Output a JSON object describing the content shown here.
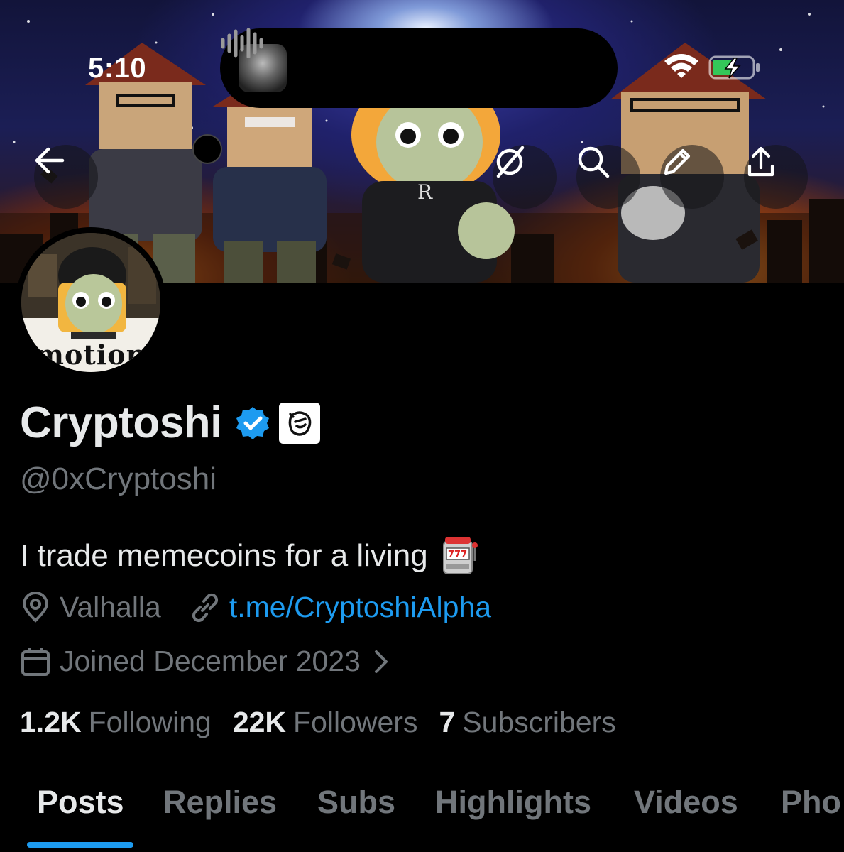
{
  "status_bar": {
    "time": "5:10",
    "icons": [
      "wifi-icon",
      "battery-charging-icon"
    ]
  },
  "dynamic_island": {
    "icons": [
      "now-playing-thumbnail",
      "waveform-icon"
    ]
  },
  "nav": {
    "buttons": [
      "back-icon",
      "grok-icon",
      "search-icon",
      "edit-icon",
      "share-icon"
    ]
  },
  "avatar": {
    "caption": "motion"
  },
  "profile": {
    "display_name": "Cryptoshi",
    "handle": "@0xCryptoshi",
    "bio": "I trade memecoins for a living",
    "bio_emoji": "slot-machine",
    "location": "Valhalla",
    "link": "t.me/CryptoshiAlpha",
    "joined": "Joined December 2023"
  },
  "stats": [
    {
      "count": "1.2K",
      "label": "Following"
    },
    {
      "count": "22K",
      "label": "Followers"
    },
    {
      "count": "7",
      "label": "Subscribers"
    }
  ],
  "tabs": [
    "Posts",
    "Replies",
    "Subs",
    "Highlights",
    "Videos",
    "Pho"
  ],
  "colors": {
    "accent": "#1d9bf0",
    "secondary_text": "#71767b",
    "primary_text": "#e7e9ea",
    "background": "#000000"
  }
}
